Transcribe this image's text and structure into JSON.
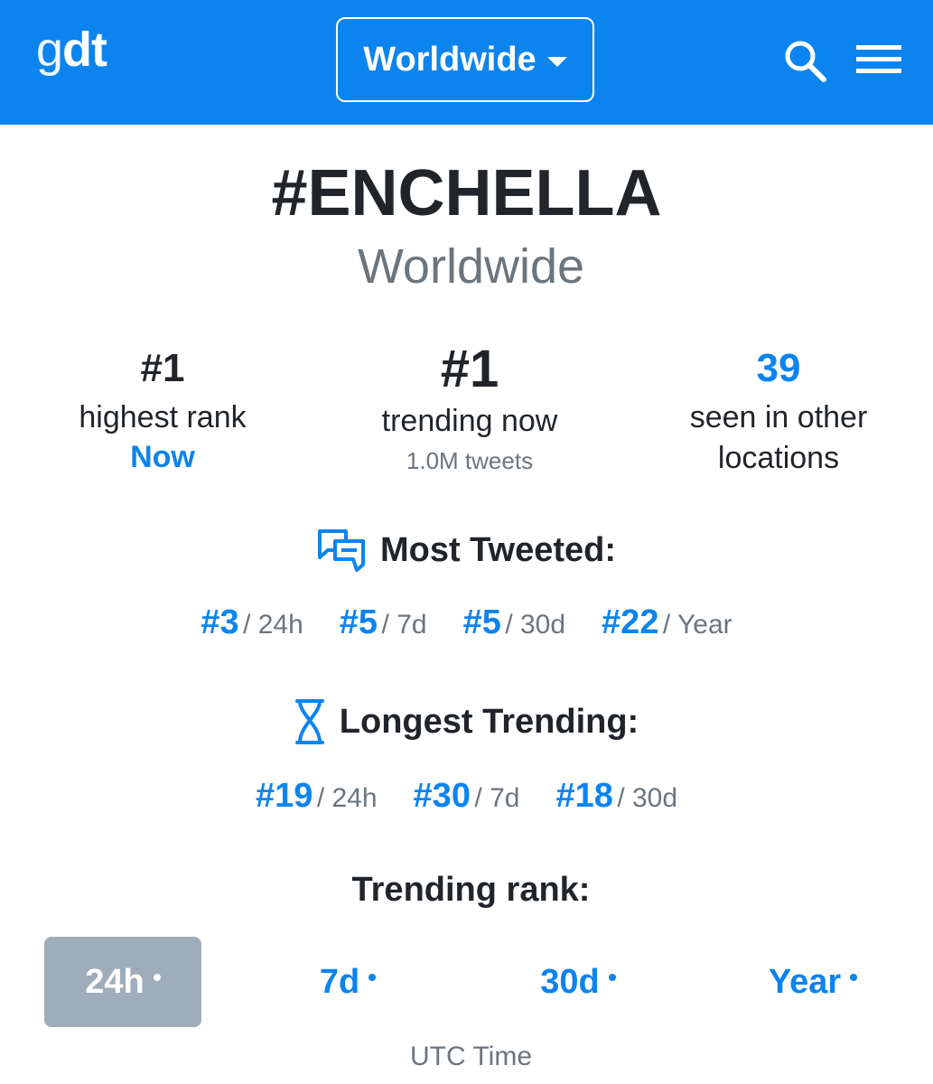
{
  "header": {
    "logo_g": "g",
    "logo_dt": "dt",
    "location_button": "Worldwide",
    "accent_color": "#0c84ef"
  },
  "trend": {
    "hashtag": "#ENCHELLA",
    "location": "Worldwide"
  },
  "stats": {
    "highest_rank": {
      "value": "#1",
      "label": "highest rank",
      "when": "Now"
    },
    "trending_now": {
      "value": "#1",
      "label": "trending now",
      "tweets": "1.0M tweets"
    },
    "other_locations": {
      "value": "39",
      "label_line1": "seen in other",
      "label_line2": "locations"
    }
  },
  "most_tweeted": {
    "title": "Most Tweeted:",
    "ranks": [
      {
        "rank": "#3",
        "period": "/ 24h"
      },
      {
        "rank": "#5",
        "period": "/ 7d"
      },
      {
        "rank": "#5",
        "period": "/ 30d"
      },
      {
        "rank": "#22",
        "period": "/ Year"
      }
    ]
  },
  "longest_trending": {
    "title": "Longest Trending:",
    "ranks": [
      {
        "rank": "#19",
        "period": "/ 24h"
      },
      {
        "rank": "#30",
        "period": "/ 7d"
      },
      {
        "rank": "#18",
        "period": "/ 30d"
      }
    ]
  },
  "trending_rank": {
    "title": "Trending rank:",
    "tabs": [
      "24h",
      "7d",
      "30d",
      "Year"
    ],
    "active_tab": "24h",
    "timezone": "UTC Time"
  },
  "icons": [
    "search-icon",
    "menu-icon",
    "chat-bubbles-icon",
    "hourglass-icon"
  ]
}
